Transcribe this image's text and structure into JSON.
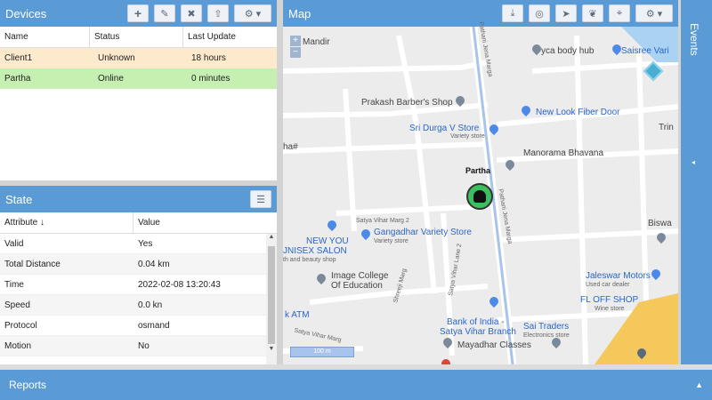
{
  "devices": {
    "title": "Devices",
    "toolbar_icons": [
      "plus-icon",
      "pencil-icon",
      "close-icon",
      "upload-icon",
      "gear-icon"
    ],
    "columns": [
      "Name",
      "Status",
      "Last Update"
    ],
    "rows": [
      {
        "name": "Client1",
        "status": "Unknown",
        "last_update": "18 hours",
        "color": "#fde9cc"
      },
      {
        "name": "Partha",
        "status": "Online",
        "last_update": "0 minutes",
        "color": "#c6efb2"
      }
    ]
  },
  "state": {
    "title": "State",
    "columns": [
      "Attribute",
      "Value"
    ],
    "sort_arrow": "↓",
    "rows": [
      {
        "attribute": "Valid",
        "value": "Yes"
      },
      {
        "attribute": "Total Distance",
        "value": "0.04 km"
      },
      {
        "attribute": "Time",
        "value": "2022-02-08 13:20:43"
      },
      {
        "attribute": "Speed",
        "value": "0.0 kn"
      },
      {
        "attribute": "Protocol",
        "value": "osmand"
      },
      {
        "attribute": "Motion",
        "value": "No"
      }
    ]
  },
  "map": {
    "title": "Map",
    "toolbar_icons": [
      "download-icon",
      "target-icon",
      "navigate-icon",
      "paw-icon",
      "crosshair-icon",
      "gear-icon"
    ],
    "zoom_in": "+",
    "zoom_out": "−",
    "scale_label": "100 m",
    "device_label": "Partha",
    "labels": {
      "mandir": "Mandir",
      "yca": "yca body hub",
      "saisree": "Saisree Vari",
      "prakash": "Prakash Barber's Shop",
      "newlook": "New Look Fiber Door",
      "sridurga": "Sri Durga V Store",
      "sridurga_sub": "Variety store",
      "trin": "Trin",
      "manorama": "Manorama Bhavana",
      "ha": "ha#",
      "satya2": "Satya Vihar Marg 2",
      "newyou": "NEW YOU",
      "salon": "JNISEX SALON",
      "salon_sub": "th and beauty shop",
      "gangadhar": "Gangadhar Variety Store",
      "gangadhar_sub": "Variety store",
      "biswa": "Biswa",
      "image_college": "Image College",
      "of_education": "Of Education",
      "jaleswar": "Jaleswar Motors",
      "jaleswar_sub": "Used car dealer",
      "fl_off": "FL OFF SHOP",
      "fl_sub": "Wine store",
      "atm": "k ATM",
      "boi": "Bank of India -",
      "boi2": "Satya Vihar Branch",
      "sai": "Sai Traders",
      "sai_sub": "Electronics store",
      "satya_marg": "Satya Vihar Marg",
      "mayadhar": "Mayadhar Classes",
      "pathani": "Pathani Jena Marga",
      "pathani2": "Pathani Jena Marga",
      "shreeji": "Shreeji Marg",
      "satya_lane": "Satya Vihar Lane 2"
    }
  },
  "events": {
    "title": "Events"
  },
  "reports": {
    "title": "Reports"
  }
}
